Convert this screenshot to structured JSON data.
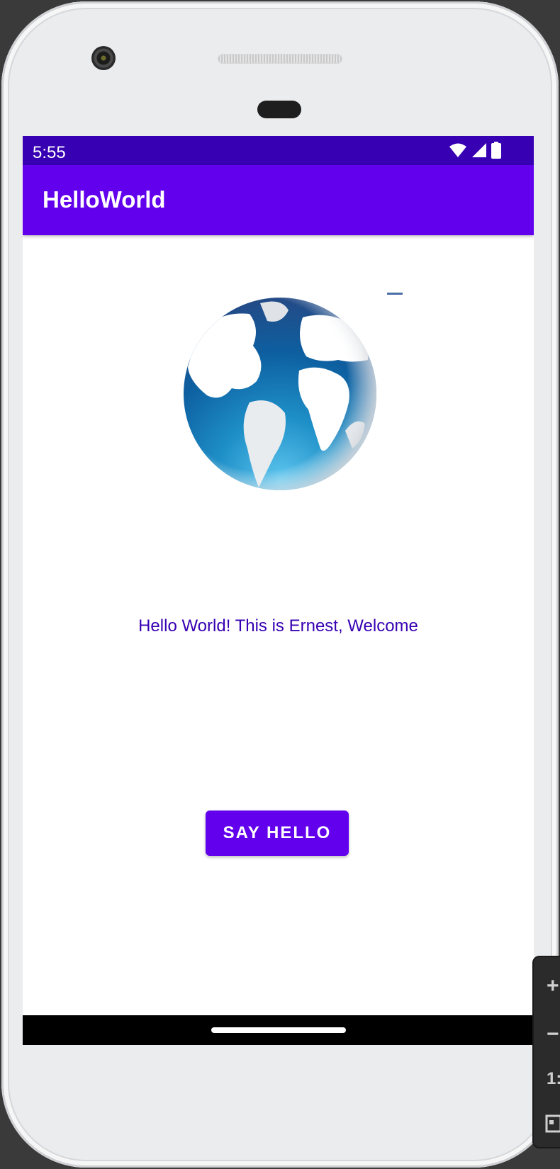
{
  "device": {
    "frame_color": "#ebecee"
  },
  "status_bar": {
    "time": "5:55",
    "icons": [
      "wifi-icon",
      "signal-icon",
      "battery-icon"
    ],
    "color": "#3700b3"
  },
  "app_bar": {
    "title": "HelloWorld",
    "color": "#6200ee"
  },
  "content": {
    "image": "globe-image",
    "message": "Hello World! This is Ernest, Welcome",
    "message_color": "#3700b3",
    "button_label": "SAY HELLO",
    "button_color": "#6200ee"
  },
  "side_toolbar": {
    "items": [
      "+",
      "−",
      "1:"
    ]
  }
}
